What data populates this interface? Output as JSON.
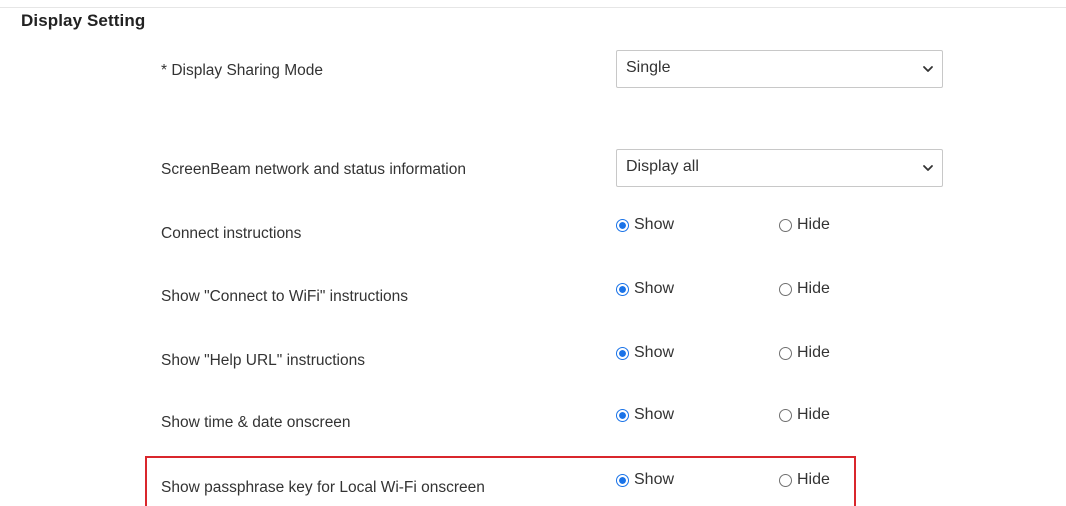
{
  "section": {
    "title": "Display Setting"
  },
  "display_sharing_mode": {
    "label": "* Display Sharing Mode",
    "selected": "Single"
  },
  "network_status_info": {
    "label": "ScreenBeam network and status information",
    "selected": "Display all"
  },
  "radio_options": {
    "show": "Show",
    "hide": "Hide"
  },
  "settings": [
    {
      "label": "Connect instructions",
      "value": "Show"
    },
    {
      "label": "Show \"Connect to WiFi\" instructions",
      "value": "Show"
    },
    {
      "label": "Show \"Help URL\" instructions",
      "value": "Show"
    },
    {
      "label": "Show time & date onscreen",
      "value": "Show"
    },
    {
      "label": "Show passphrase key for Local Wi-Fi onscreen",
      "value": "Show",
      "highlighted": true
    }
  ],
  "colors": {
    "accent": "#1a73e8",
    "highlight": "#d9262c"
  },
  "icons": {
    "dropdown": "chevron-down-icon",
    "radio_selected": "radio-selected-icon",
    "radio_unselected": "radio-unselected-icon"
  }
}
